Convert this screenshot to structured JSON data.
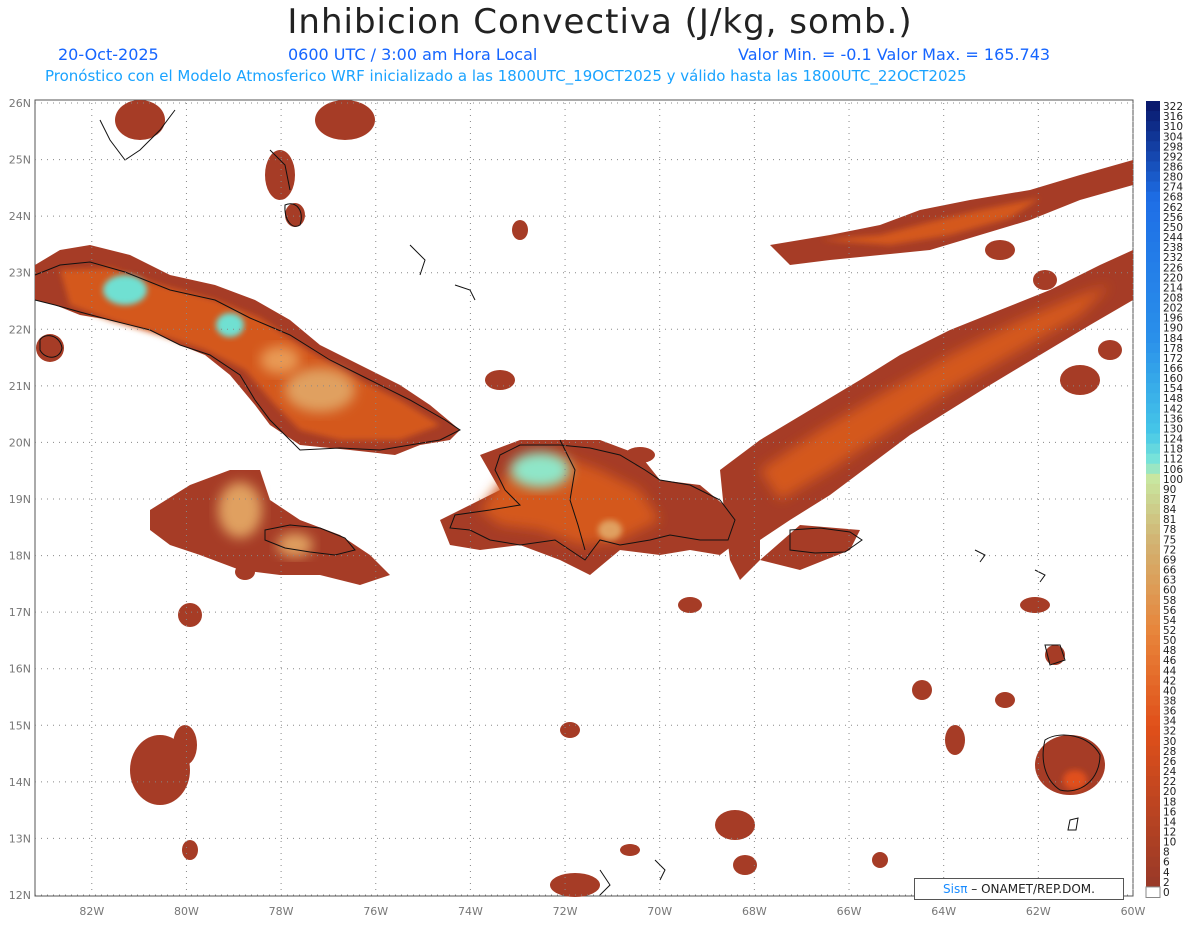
{
  "header": {
    "title": "Inhibicion Convectiva (J/kg, somb.)",
    "date": "20-Oct-2025",
    "time": "0600 UTC / 3:00 am Hora Local",
    "minmax": "Valor Min. = -0.1  Valor Max. = 165.743",
    "model_line": "Pronóstico con el Modelo Atmosferico WRF inicializado a las 1800UTC_19OCT2025 y válido hasta las  1800UTC_22OCT2025"
  },
  "map": {
    "lat_labels": [
      "26N",
      "25N",
      "24N",
      "23N",
      "22N",
      "21N",
      "20N",
      "19N",
      "18N",
      "17N",
      "16N",
      "15N",
      "14N",
      "13N",
      "12N"
    ],
    "lat_values": [
      26,
      25,
      24,
      23,
      22,
      21,
      20,
      19,
      18,
      17,
      16,
      15,
      14,
      13,
      12
    ],
    "lon_labels": [
      "82W",
      "80W",
      "78W",
      "76W",
      "74W",
      "72W",
      "70W",
      "68W",
      "66W",
      "64W",
      "62W",
      "60W"
    ],
    "lon_values": [
      -82,
      -80,
      -78,
      -76,
      -74,
      -72,
      -70,
      -68,
      -66,
      -64,
      -62,
      -60
    ]
  },
  "colorbar": {
    "labels": [
      "322",
      "316",
      "310",
      "304",
      "298",
      "292",
      "286",
      "280",
      "274",
      "268",
      "262",
      "256",
      "250",
      "244",
      "238",
      "232",
      "226",
      "220",
      "214",
      "208",
      "202",
      "196",
      "190",
      "184",
      "178",
      "172",
      "166",
      "160",
      "154",
      "148",
      "142",
      "136",
      "130",
      "124",
      "118",
      "112",
      "106",
      "100",
      "90",
      "87",
      "84",
      "81",
      "78",
      "75",
      "72",
      "69",
      "66",
      "63",
      "60",
      "58",
      "56",
      "54",
      "52",
      "50",
      "48",
      "46",
      "44",
      "42",
      "40",
      "38",
      "36",
      "34",
      "32",
      "30",
      "28",
      "26",
      "24",
      "22",
      "20",
      "18",
      "16",
      "14",
      "12",
      "10",
      "8",
      "6",
      "4",
      "2",
      "0"
    ],
    "colors": {
      "high": "#0a1a6e",
      "blue": "#1e6ee6",
      "cyan": "#45c6e8",
      "lightcyan": "#7fe6d8",
      "pale": "#c8e6a0",
      "tan": "#d2b473",
      "orange": "#e8843a",
      "redorange": "#e0501a",
      "brown": "#9a3a28"
    }
  },
  "credit": {
    "brand": "Sisπ",
    "text": "– ONAMET/REP.DOM."
  }
}
